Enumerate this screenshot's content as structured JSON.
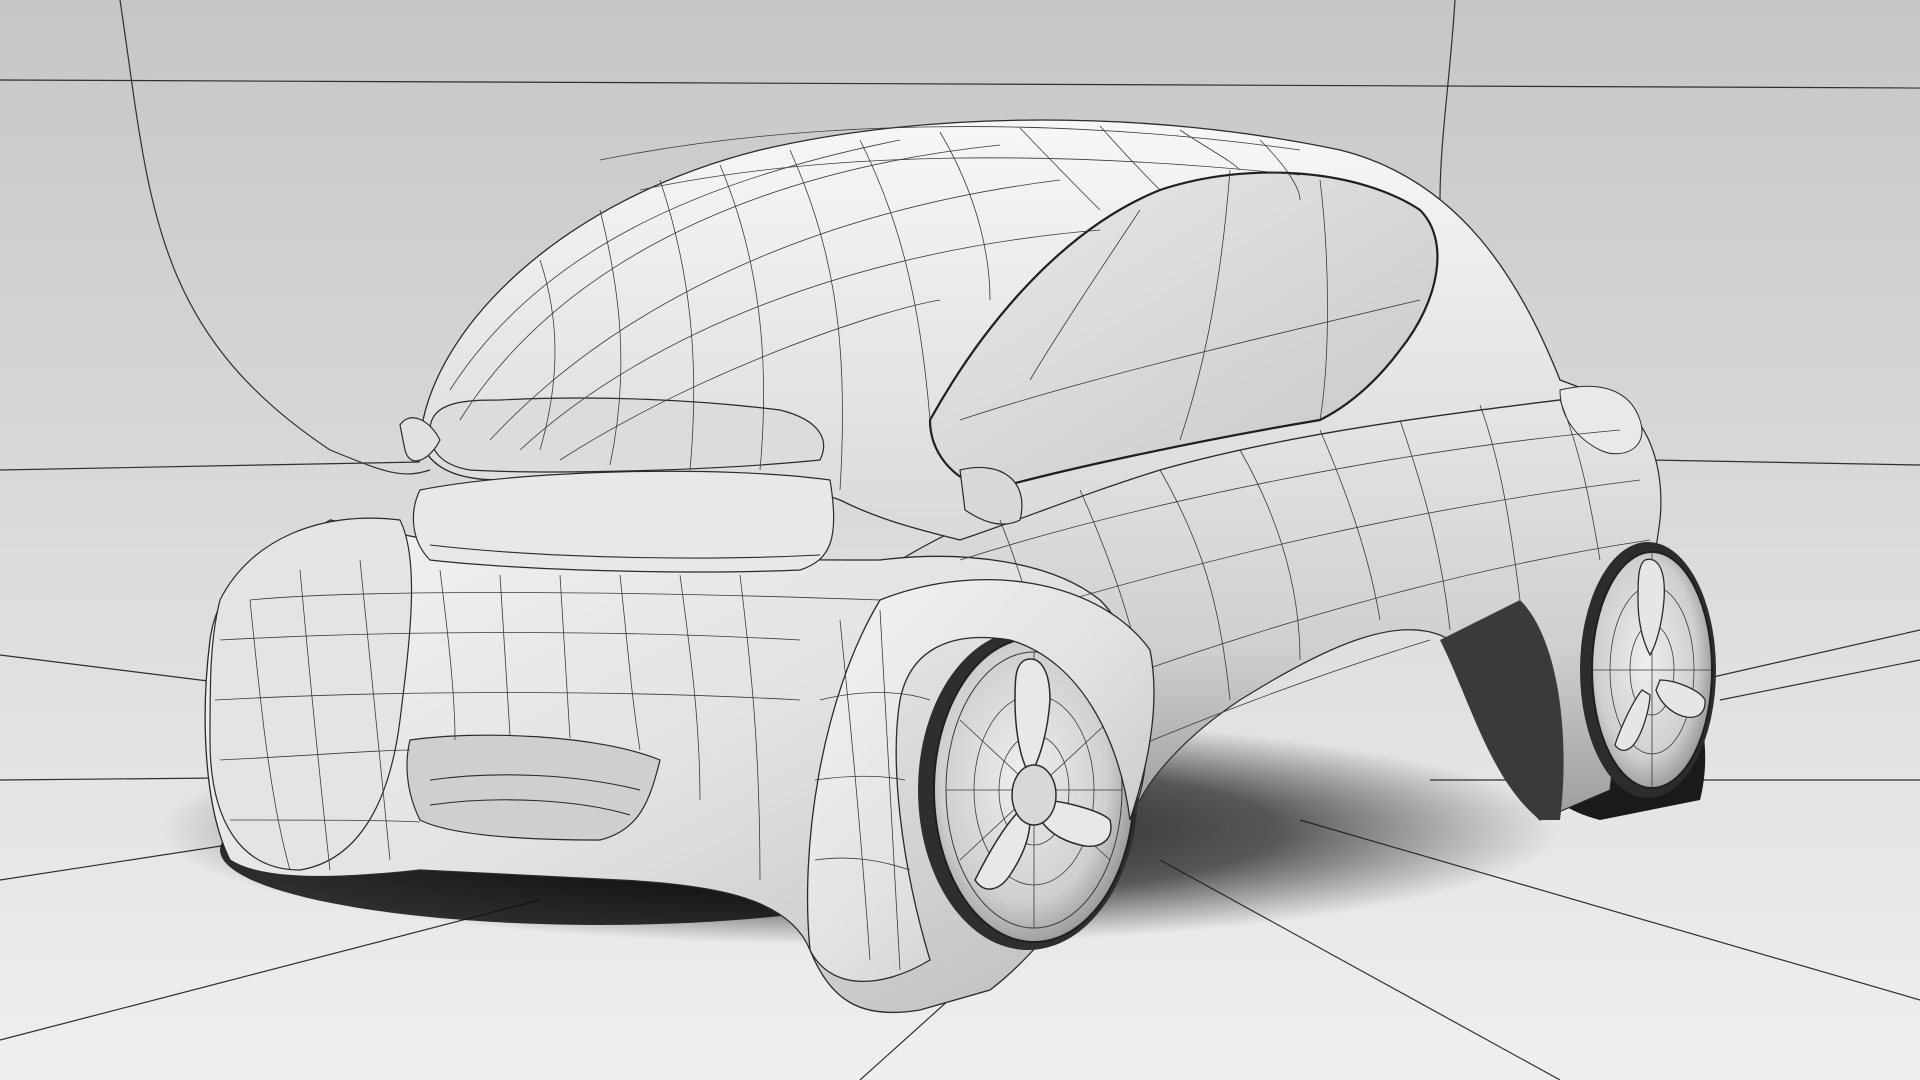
{
  "scene": {
    "subject": "car-wireframe-render",
    "colors": {
      "background_top": "#c9c9c9",
      "background_bottom": "#ebebeb",
      "body_light": "#f2f2f2",
      "body_mid": "#d6d6d6",
      "body_dark": "#9a9a9a",
      "shadow": "#151515",
      "wire": "#2a2a2a"
    }
  }
}
